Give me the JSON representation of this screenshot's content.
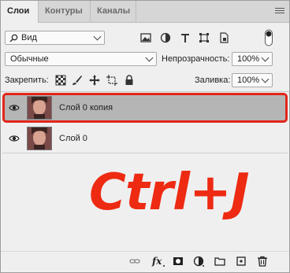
{
  "tabs": [
    {
      "label": "Слои"
    },
    {
      "label": "Контуры"
    },
    {
      "label": "Каналы"
    }
  ],
  "filter": {
    "selected": "Вид"
  },
  "blend": {
    "mode": "Обычные",
    "opacity_label": "Непрозрачность:",
    "opacity_value": "100%"
  },
  "lock": {
    "label": "Закрепить:",
    "fill_label": "Заливка:",
    "fill_value": "100%"
  },
  "layers": [
    {
      "name": "Слой 0 копия",
      "selected": true
    },
    {
      "name": "Слой 0",
      "selected": false
    }
  ],
  "overlay": {
    "shortcut": "Ctrl+J",
    "color": "#ee2a12"
  },
  "bottom_icons": [
    "link-icon",
    "fx-icon",
    "mask-icon",
    "adjustment-icon",
    "folder-icon",
    "new-layer-icon",
    "trash-icon"
  ],
  "colors": {
    "selection_border": "#e2251b",
    "selected_row": "#b5b5b5"
  }
}
